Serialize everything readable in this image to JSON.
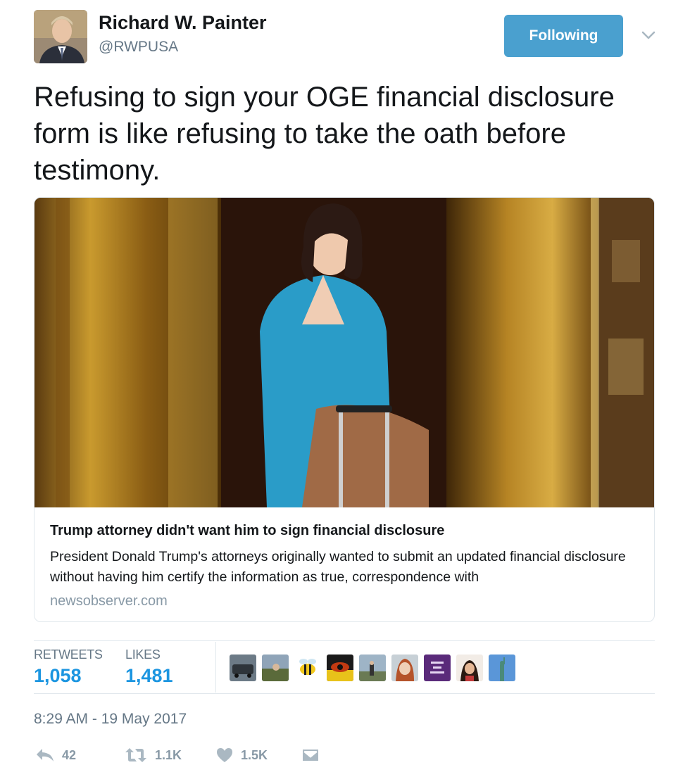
{
  "user": {
    "display_name": "Richard W. Painter",
    "handle": "@RWPUSA"
  },
  "follow_button": {
    "label": "Following"
  },
  "tweet": {
    "text": "Refusing to sign your OGE financial disclosure form is like refusing to take the oath before testimony."
  },
  "card": {
    "title": "Trump attorney didn't want him to sign financial disclosure",
    "description": "President Donald Trump's attorneys originally wanted to submit an updated financial disclosure without having him certify the information as true, correspondence with",
    "domain": "newsobserver.com"
  },
  "stats": {
    "retweets_label": "RETWEETS",
    "retweets_value": "1,058",
    "likes_label": "LIKES",
    "likes_value": "1,481"
  },
  "timestamp": "8:29 AM - 19 May 2017",
  "actions": {
    "reply_count": "42",
    "retweet_count": "1.1K",
    "like_count": "1.5K"
  },
  "colors": {
    "follow_button": "#4aa0cf",
    "stat_value": "#1b95e0",
    "secondary_text": "#657786",
    "action_icon": "#aab8c2"
  }
}
